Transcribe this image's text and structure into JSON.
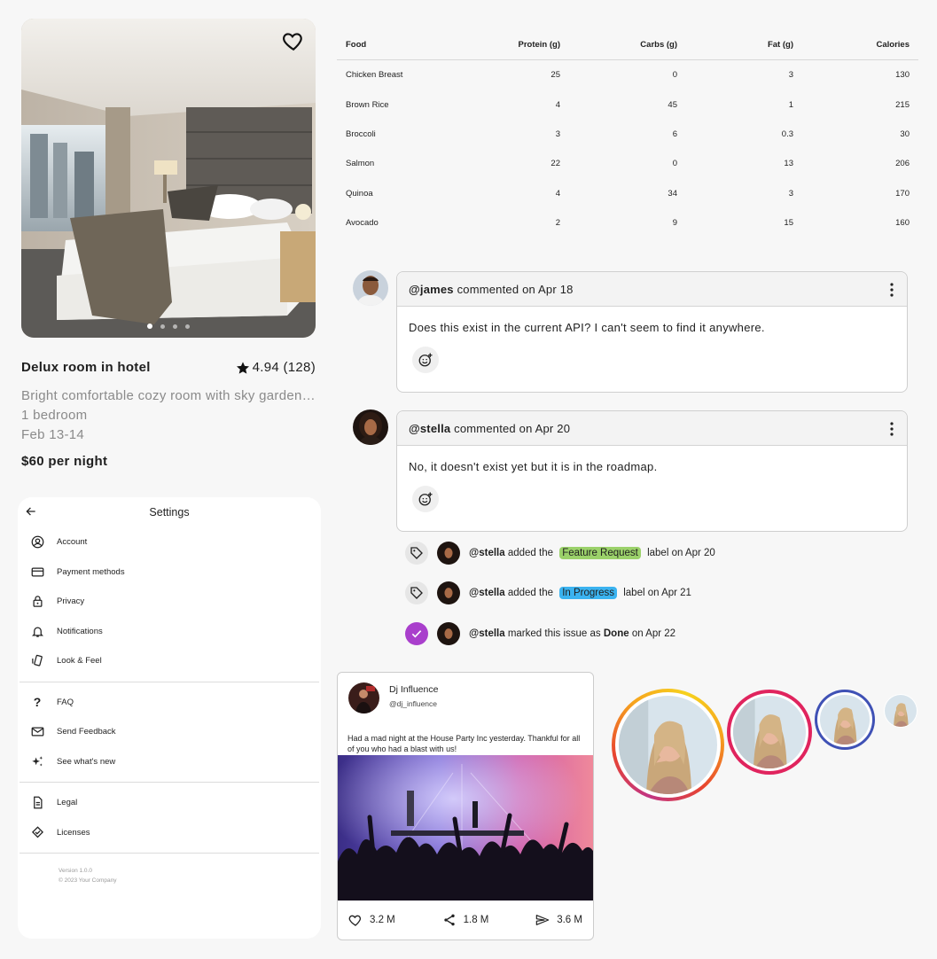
{
  "hotel": {
    "title": "Delux room in hotel",
    "rating": "4.94 (128)",
    "description": "Bright comfortable cozy room with sky garden view",
    "bedrooms": "1 bedroom",
    "dates": "Feb 13-14",
    "price": "$60 per night",
    "photo_pages": 4,
    "active_page": 1
  },
  "settings": {
    "title": "Settings",
    "items": [
      {
        "label": "Account",
        "icon": "account-circle-icon"
      },
      {
        "label": "Payment methods",
        "icon": "credit-card-icon"
      },
      {
        "label": "Privacy",
        "icon": "lock-icon"
      },
      {
        "label": "Notifications",
        "icon": "bell-icon"
      },
      {
        "label": "Look & Feel",
        "icon": "phone-rotate-icon"
      },
      {
        "label": "FAQ",
        "icon": "question-mark-icon"
      },
      {
        "label": "Send Feedback",
        "icon": "mail-icon"
      },
      {
        "label": "See what's new",
        "icon": "sparkle-icon"
      },
      {
        "label": "Legal",
        "icon": "document-icon"
      },
      {
        "label": "Licenses",
        "icon": "license-badge-icon"
      }
    ],
    "version": "Version 1.0.0",
    "copyright": "© 2023 Your Company"
  },
  "nutrition": {
    "headers": [
      "Food",
      "Protein (g)",
      "Carbs (g)",
      "Fat (g)",
      "Calories"
    ],
    "rows": [
      [
        "Chicken Breast",
        "25",
        "0",
        "3",
        "130"
      ],
      [
        "Brown Rice",
        "4",
        "45",
        "1",
        "215"
      ],
      [
        "Broccoli",
        "3",
        "6",
        "0.3",
        "30"
      ],
      [
        "Salmon",
        "22",
        "0",
        "13",
        "206"
      ],
      [
        "Quinoa",
        "4",
        "34",
        "3",
        "170"
      ],
      [
        "Avocado",
        "2",
        "9",
        "15",
        "160"
      ]
    ]
  },
  "comments": [
    {
      "user": "@james",
      "meta": "commented on Apr 18",
      "body": "Does this exist in the current API? I can't seem to find it anywhere."
    },
    {
      "user": "@stella",
      "meta": "commented on Apr 20",
      "body": "No, it doesn't exist yet but it is in the roadmap."
    }
  ],
  "events": [
    {
      "icon": "tag-icon",
      "user": "@stella",
      "pre": "added the",
      "label": "Feature Request",
      "label_color": "#9bd16a",
      "post": "label on Apr 20"
    },
    {
      "icon": "tag-icon",
      "user": "@stella",
      "pre": "added the",
      "label": "In Progress",
      "label_color": "#3bb3f0",
      "post": "label on Apr 21"
    },
    {
      "icon": "check-circle-icon",
      "user": "@stella",
      "pre": "marked this issue as",
      "status": "Done",
      "post": "on Apr 22"
    }
  ],
  "post": {
    "name": "Dj Influence",
    "handle": "@dj_influence",
    "text": "Had a mad night at the House Party Inc yesterday. Thankful for all of you who had a blast with us!",
    "likes": "3.2 M",
    "shares": "1.8 M",
    "sends": "3.6 M"
  },
  "colors": {
    "accent_purple": "#a93fcc",
    "story_ring_gradient": [
      "#f6d21e",
      "#e8452f",
      "#c13584"
    ],
    "story_ring_pink": "#e0245e",
    "story_ring_blue": "#3f51b5"
  }
}
